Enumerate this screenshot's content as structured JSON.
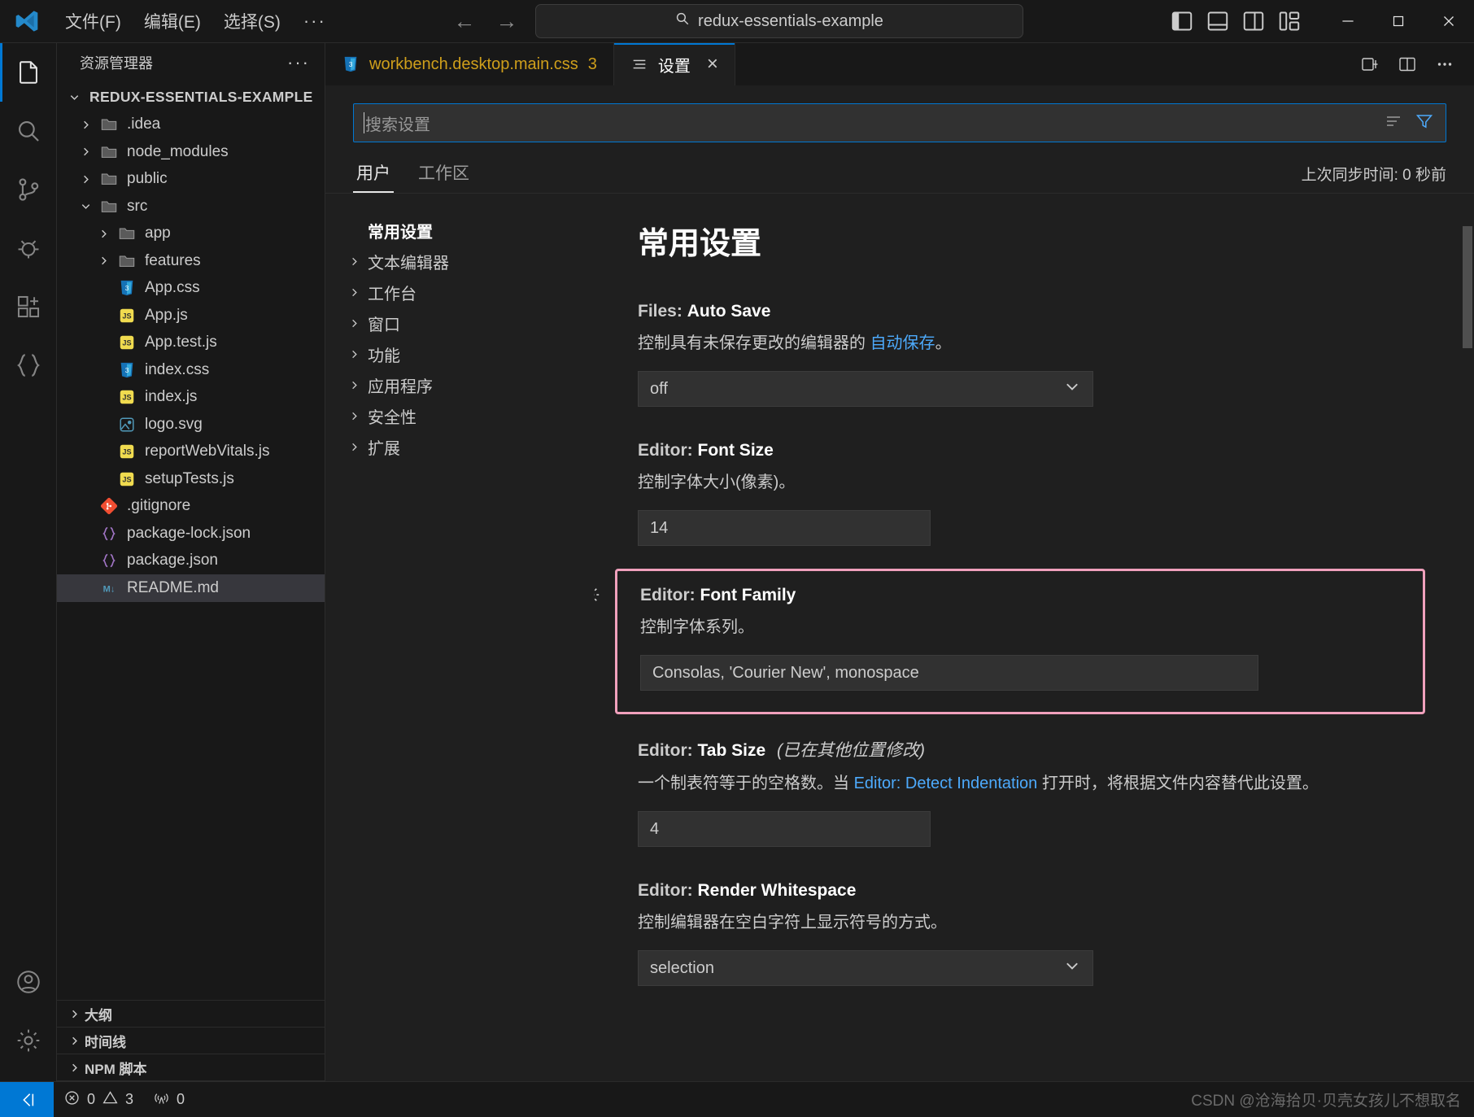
{
  "titlebar": {
    "logo_icon": "vscode-logo-icon",
    "menus": [
      {
        "label": "文件(F)",
        "name": "menu-file"
      },
      {
        "label": "编辑(E)",
        "name": "menu-edit"
      },
      {
        "label": "选择(S)",
        "name": "menu-selection"
      }
    ],
    "more_label": "···",
    "nav_back": "←",
    "nav_forward": "→",
    "command_center_text": "redux-essentials-example",
    "layout_icons": [
      "toggle-primary-sidebar-icon",
      "toggle-panel-icon",
      "toggle-secondary-sidebar-icon",
      "customize-layout-icon"
    ],
    "window_controls": [
      "minimize-icon",
      "maximize-icon",
      "close-icon"
    ]
  },
  "activitybar": {
    "items": [
      {
        "name": "activity-explorer",
        "icon": "files-icon",
        "active": true
      },
      {
        "name": "activity-search",
        "icon": "search-icon",
        "active": false
      },
      {
        "name": "activity-source-control",
        "icon": "source-control-icon",
        "active": false
      },
      {
        "name": "activity-run-debug",
        "icon": "run-debug-icon",
        "active": false
      },
      {
        "name": "activity-extensions",
        "icon": "extensions-icon",
        "active": false
      },
      {
        "name": "activity-remote",
        "icon": "braces-icon",
        "active": false
      }
    ],
    "bottom": [
      {
        "name": "activity-accounts",
        "icon": "account-icon"
      },
      {
        "name": "activity-settings",
        "icon": "gear-icon"
      }
    ]
  },
  "sidebar": {
    "header_title": "资源管理器",
    "header_more": "···",
    "root": {
      "label": "REDUX-ESSENTIALS-EXAMPLE",
      "expanded": true
    },
    "tree": [
      {
        "label": ".idea",
        "type": "folder",
        "indent": 1,
        "expanded": false
      },
      {
        "label": "node_modules",
        "type": "folder",
        "indent": 1,
        "expanded": false
      },
      {
        "label": "public",
        "type": "folder",
        "indent": 1,
        "expanded": false
      },
      {
        "label": "src",
        "type": "folder",
        "indent": 1,
        "expanded": true
      },
      {
        "label": "app",
        "type": "folder",
        "indent": 2,
        "expanded": false
      },
      {
        "label": "features",
        "type": "folder",
        "indent": 2,
        "expanded": false
      },
      {
        "label": "App.css",
        "type": "css",
        "indent": 2
      },
      {
        "label": "App.js",
        "type": "js",
        "indent": 2
      },
      {
        "label": "App.test.js",
        "type": "js",
        "indent": 2
      },
      {
        "label": "index.css",
        "type": "css",
        "indent": 2
      },
      {
        "label": "index.js",
        "type": "js",
        "indent": 2
      },
      {
        "label": "logo.svg",
        "type": "svg",
        "indent": 2
      },
      {
        "label": "reportWebVitals.js",
        "type": "js",
        "indent": 2
      },
      {
        "label": "setupTests.js",
        "type": "js",
        "indent": 2
      },
      {
        "label": ".gitignore",
        "type": "git",
        "indent": 1
      },
      {
        "label": "package-lock.json",
        "type": "json",
        "indent": 1
      },
      {
        "label": "package.json",
        "type": "json",
        "indent": 1
      },
      {
        "label": "README.md",
        "type": "md",
        "indent": 1,
        "selected": true
      }
    ],
    "panes": [
      {
        "label": "大纲",
        "name": "pane-outline"
      },
      {
        "label": "时间线",
        "name": "pane-timeline"
      },
      {
        "label": "NPM 脚本",
        "name": "pane-npm-scripts"
      }
    ]
  },
  "tabs": [
    {
      "label": "workbench.desktop.main.css",
      "badge": "3",
      "icon": "css-file-icon",
      "active": false,
      "kind": "css"
    },
    {
      "label": "设置",
      "badge": "",
      "icon": "settings-tab-icon",
      "active": true,
      "kind": "settings",
      "close": "×"
    }
  ],
  "tab_actions": [
    "split-editor-right-icon",
    "split-editor-icon",
    "more-actions-icon"
  ],
  "settings": {
    "search_placeholder": "搜索设置",
    "search_icons": [
      "clear-filters-icon",
      "filter-icon"
    ],
    "subtabs": [
      {
        "label": "用户",
        "active": true,
        "name": "tab-user"
      },
      {
        "label": "工作区",
        "active": false,
        "name": "tab-workspace"
      }
    ],
    "sync_status": "上次同步时间: 0 秒前",
    "toc": [
      {
        "label": "常用设置",
        "active": true,
        "has_chevron": false
      },
      {
        "label": "文本编辑器",
        "active": false,
        "has_chevron": true
      },
      {
        "label": "工作台",
        "active": false,
        "has_chevron": true
      },
      {
        "label": "窗口",
        "active": false,
        "has_chevron": true
      },
      {
        "label": "功能",
        "active": false,
        "has_chevron": true
      },
      {
        "label": "应用程序",
        "active": false,
        "has_chevron": true
      },
      {
        "label": "安全性",
        "active": false,
        "has_chevron": true
      },
      {
        "label": "扩展",
        "active": false,
        "has_chevron": true
      }
    ],
    "section_title": "常用设置",
    "items": [
      {
        "category": "Files:",
        "name": "Auto Save",
        "modified_note": "",
        "desc_before": "控制具有未保存更改的编辑器的 ",
        "desc_link": "自动保存",
        "desc_after": "。",
        "control": "select",
        "value": "off",
        "highlighted": false,
        "gear": false
      },
      {
        "category": "Editor:",
        "name": "Font Size",
        "modified_note": "",
        "desc_before": "控制字体大小(像素)。",
        "desc_link": "",
        "desc_after": "",
        "control": "input",
        "value": "14",
        "highlighted": false,
        "gear": false
      },
      {
        "category": "Editor:",
        "name": "Font Family",
        "modified_note": "",
        "desc_before": "控制字体系列。",
        "desc_link": "",
        "desc_after": "",
        "control": "input-wide",
        "value": "Consolas, 'Courier New', monospace",
        "highlighted": true,
        "gear": true
      },
      {
        "category": "Editor:",
        "name": "Tab Size",
        "modified_note": "(已在其他位置修改)",
        "desc_before": "一个制表符等于的空格数。当 ",
        "desc_link": "Editor: Detect Indentation",
        "desc_after": " 打开时，将根据文件内容替代此设置。",
        "control": "input",
        "value": "4",
        "highlighted": false,
        "gear": false
      },
      {
        "category": "Editor:",
        "name": "Render Whitespace",
        "modified_note": "",
        "desc_before": "控制编辑器在空白字符上显示符号的方式。",
        "desc_link": "",
        "desc_after": "",
        "control": "select",
        "value": "selection",
        "highlighted": false,
        "gear": false
      }
    ]
  },
  "statusbar": {
    "remote_icon": "remote-window-icon",
    "errors_icon": "error-icon",
    "errors": "0",
    "warnings_icon": "warning-icon",
    "warnings": "3",
    "ports_icon": "radio-tower-icon",
    "ports": "0",
    "watermark": "CSDN @沧海拾贝·贝壳女孩儿不想取名"
  },
  "colors": {
    "accent": "#0078d4",
    "highlight_border": "#f0a0bc",
    "link": "#4daafc",
    "tab_css_text": "#cf9f1b"
  }
}
